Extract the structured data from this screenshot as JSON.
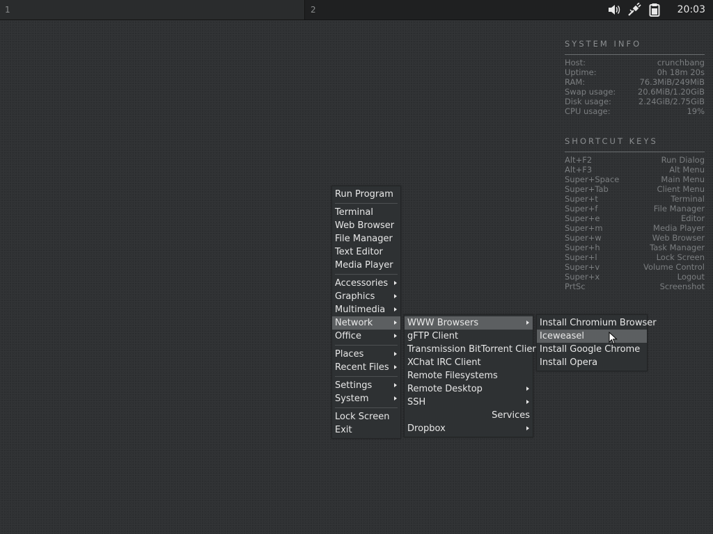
{
  "panel": {
    "workspaces": [
      "1",
      "2"
    ],
    "clock": "20:03",
    "tray_icons": [
      "volume-icon",
      "network-cable-icon",
      "clipboard-icon"
    ]
  },
  "system_info": {
    "title": "SYSTEM INFO",
    "rows": [
      {
        "label": "Host:",
        "value": "crunchbang"
      },
      {
        "label": "Uptime:",
        "value": "0h 18m 20s"
      },
      {
        "label": "RAM:",
        "value": "76.3MiB/249MiB"
      },
      {
        "label": "Swap usage:",
        "value": "20.6MiB/1.20GiB"
      },
      {
        "label": "Disk usage:",
        "value": "2.24GiB/2.75GiB"
      },
      {
        "label": "CPU usage:",
        "value": "19%"
      }
    ]
  },
  "shortcut_keys": {
    "title": "SHORTCUT KEYS",
    "rows": [
      {
        "key": "Alt+F2",
        "action": "Run Dialog"
      },
      {
        "key": "Alt+F3",
        "action": "Alt Menu"
      },
      {
        "key": "Super+Space",
        "action": "Main Menu"
      },
      {
        "key": "Super+Tab",
        "action": "Client Menu"
      },
      {
        "key": "Super+t",
        "action": "Terminal"
      },
      {
        "key": "Super+f",
        "action": "File Manager"
      },
      {
        "key": "Super+e",
        "action": "Editor"
      },
      {
        "key": "Super+m",
        "action": "Media Player"
      },
      {
        "key": "Super+w",
        "action": "Web Browser"
      },
      {
        "key": "Super+h",
        "action": "Task Manager"
      },
      {
        "key": "Super+l",
        "action": "Lock Screen"
      },
      {
        "key": "Super+v",
        "action": "Volume Control"
      },
      {
        "key": "Super+x",
        "action": "Logout"
      },
      {
        "key": "PrtSc",
        "action": "Screenshot"
      }
    ]
  },
  "main_menu": {
    "run_program": "Run Program",
    "terminal": "Terminal",
    "web_browser": "Web Browser",
    "file_manager": "File Manager",
    "text_editor": "Text Editor",
    "media_player": "Media Player",
    "accessories": "Accessories",
    "graphics": "Graphics",
    "multimedia": "Multimedia",
    "network": "Network",
    "office": "Office",
    "places": "Places",
    "recent_files": "Recent Files",
    "settings": "Settings",
    "system": "System",
    "lock_screen": "Lock Screen",
    "exit": "Exit"
  },
  "network_menu": {
    "www_browsers": "WWW Browsers",
    "gftp": "gFTP Client",
    "transmission": "Transmission BitTorrent Client",
    "xchat": "XChat IRC Client",
    "remote_fs": "Remote Filesystems",
    "remote_desktop": "Remote Desktop",
    "ssh": "SSH",
    "services": "Services",
    "dropbox": "Dropbox"
  },
  "www_menu": {
    "chromium": "Install Chromium Browser",
    "iceweasel": "Iceweasel",
    "chrome": "Install Google Chrome",
    "opera": "Install Opera"
  }
}
